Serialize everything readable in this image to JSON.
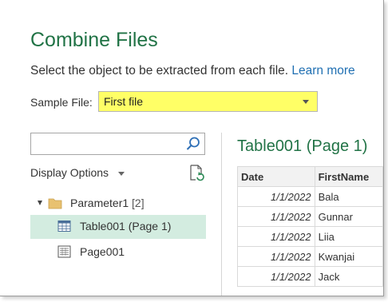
{
  "dialog": {
    "title": "Combine Files",
    "subtitle": "Select the object to be extracted from each file.",
    "learn_more": "Learn more",
    "sample_file_label": "Sample File:",
    "sample_file_value": "First file"
  },
  "navigator": {
    "search": {
      "value": "",
      "placeholder": ""
    },
    "display_options_label": "Display Options",
    "tree": [
      {
        "label": "Parameter1",
        "count": "[2]",
        "type": "folder",
        "expanded": true
      },
      {
        "label": "Table001 (Page 1)",
        "type": "table",
        "selected": true
      },
      {
        "label": "Page001",
        "type": "page",
        "selected": false
      }
    ]
  },
  "preview": {
    "title": "Table001 (Page 1)",
    "columns": [
      "Date",
      "FirstName"
    ],
    "rows": [
      [
        "1/1/2022",
        "Bala"
      ],
      [
        "1/1/2022",
        "Gunnar"
      ],
      [
        "1/1/2022",
        "Liia"
      ],
      [
        "1/1/2022",
        "Kwanjai"
      ],
      [
        "1/1/2022",
        "Jack"
      ]
    ]
  },
  "colors": {
    "accent_green": "#217346",
    "link_blue": "#1f6fb2",
    "highlight_yellow": "#ffff66",
    "selection_green": "#d3ece0"
  },
  "icons": {
    "search": "search-icon",
    "refresh": "refresh-icon",
    "folder": "folder-icon",
    "table": "table-icon",
    "page": "page-icon"
  }
}
